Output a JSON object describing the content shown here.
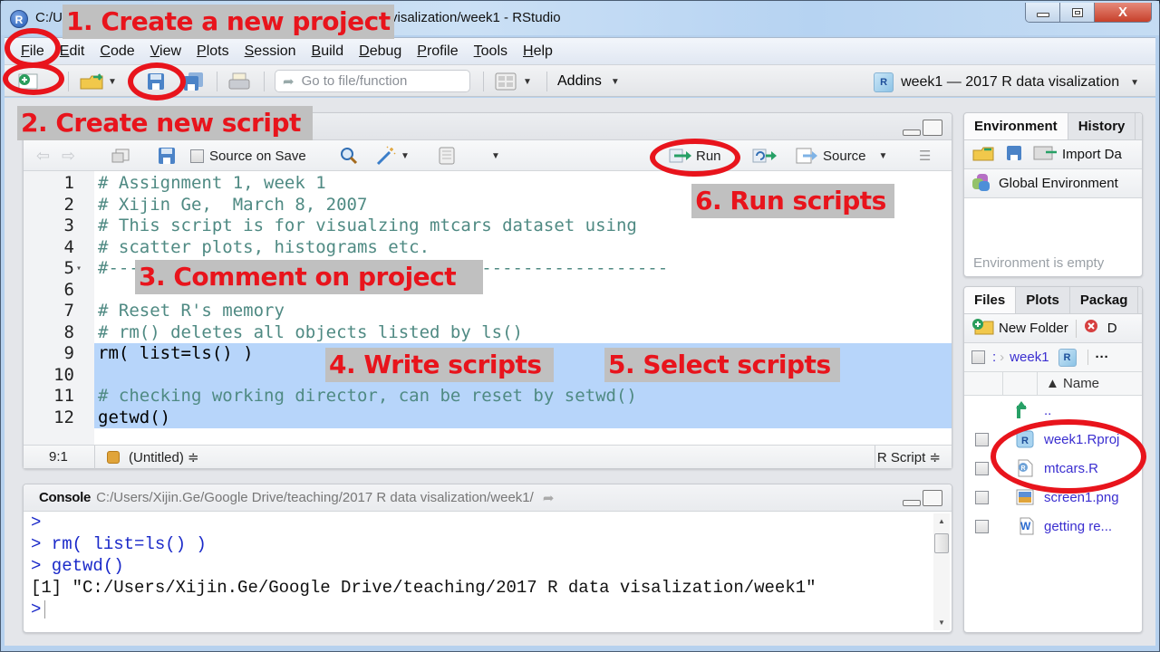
{
  "window": {
    "title_prefix": "C:/U",
    "title_suffix": "visalization/week1 - RStudio",
    "minimize_label": "minimize",
    "maximize_label": "maximize",
    "close_label": "X"
  },
  "menubar": {
    "items": [
      "File",
      "Edit",
      "Code",
      "View",
      "Plots",
      "Session",
      "Build",
      "Debug",
      "Profile",
      "Tools",
      "Help"
    ]
  },
  "toolbar": {
    "goto_placeholder": "Go to file/function",
    "addins_label": "Addins",
    "project_label": "week1 — 2017 R data visalization"
  },
  "source": {
    "source_on_save_label": "Source on Save",
    "run_label": "Run",
    "source_label": "Source",
    "lines": [
      {
        "n": "1",
        "text": "# Assignment 1, week 1",
        "type": "comment",
        "selected": false
      },
      {
        "n": "2",
        "text": "# Xijin Ge,  March 8, 2007",
        "type": "comment",
        "selected": false
      },
      {
        "n": "3",
        "text": "# This script is for visualzing mtcars dataset using",
        "type": "comment",
        "selected": false
      },
      {
        "n": "4",
        "text": "# scatter plots, histograms etc.",
        "type": "comment",
        "selected": false
      },
      {
        "n": "5",
        "text": "#------------------------------------------------------",
        "type": "comment",
        "selected": false
      },
      {
        "n": "6",
        "text": "",
        "type": "code",
        "selected": false
      },
      {
        "n": "7",
        "text": "# Reset R's memory",
        "type": "comment",
        "selected": false
      },
      {
        "n": "8",
        "text": "# rm() deletes all objects listed by ls()",
        "type": "comment",
        "selected": false
      },
      {
        "n": "9",
        "text": "rm( list=ls() )",
        "type": "code",
        "selected": true
      },
      {
        "n": "10",
        "text": "",
        "type": "code",
        "selected": true
      },
      {
        "n": "11",
        "text": "# checking working director, can be reset by setwd()",
        "type": "comment",
        "selected": true
      },
      {
        "n": "12",
        "text": "getwd()",
        "type": "code",
        "selected": true
      }
    ],
    "status": {
      "position": "9:1",
      "scope": "(Untitled) ≑",
      "file_type": "R Script ≑"
    }
  },
  "console": {
    "label": "Console",
    "path": "C:/Users/Xijin.Ge/Google Drive/teaching/2017 R data visalization/week1/",
    "lines": [
      {
        "prompt": ">",
        "text": "",
        "kind": "in"
      },
      {
        "prompt": ">",
        "text": " rm( list=ls() )",
        "kind": "in"
      },
      {
        "prompt": ">",
        "text": " getwd()",
        "kind": "in"
      },
      {
        "prompt": "",
        "text": "[1] \"C:/Users/Xijin.Ge/Google Drive/teaching/2017 R data visalization/week1\"",
        "kind": "out"
      },
      {
        "prompt": ">",
        "text": "",
        "kind": "cursor"
      }
    ]
  },
  "environment": {
    "tabs": [
      "Environment",
      "History"
    ],
    "import_label": "Import Da",
    "scope_label": "Global Environment",
    "empty_text": "Environment is empty"
  },
  "files": {
    "tabs": [
      "Files",
      "Plots",
      "Packag"
    ],
    "new_folder_label": "New Folder",
    "delete_label": "D",
    "breadcrumb_sep": ":",
    "breadcrumb_current": "week1",
    "more_label": "···",
    "name_header": "▲ Name",
    "up_label": "..",
    "items": [
      {
        "name": "week1.Rproj",
        "icon": "rproj-icon"
      },
      {
        "name": "mtcars.R",
        "icon": "r-script-icon"
      },
      {
        "name": "screen1.png",
        "icon": "image-icon"
      },
      {
        "name": "getting re...",
        "icon": "word-doc-icon"
      }
    ]
  },
  "annotations": {
    "a1": "1. Create a new project",
    "a2": "2. Create new script",
    "a3": "3. Comment on project",
    "a4": "4. Write scripts",
    "a5": "5. Select scripts",
    "a6": "6. Run scripts"
  },
  "colors": {
    "annotation_text": "#e8141c",
    "annotation_bg": "#c0c0c0",
    "selection": "#b7d5fa",
    "comment": "#4f8a83",
    "console_input": "#1a29c9",
    "file_link": "#3a2ed0"
  }
}
